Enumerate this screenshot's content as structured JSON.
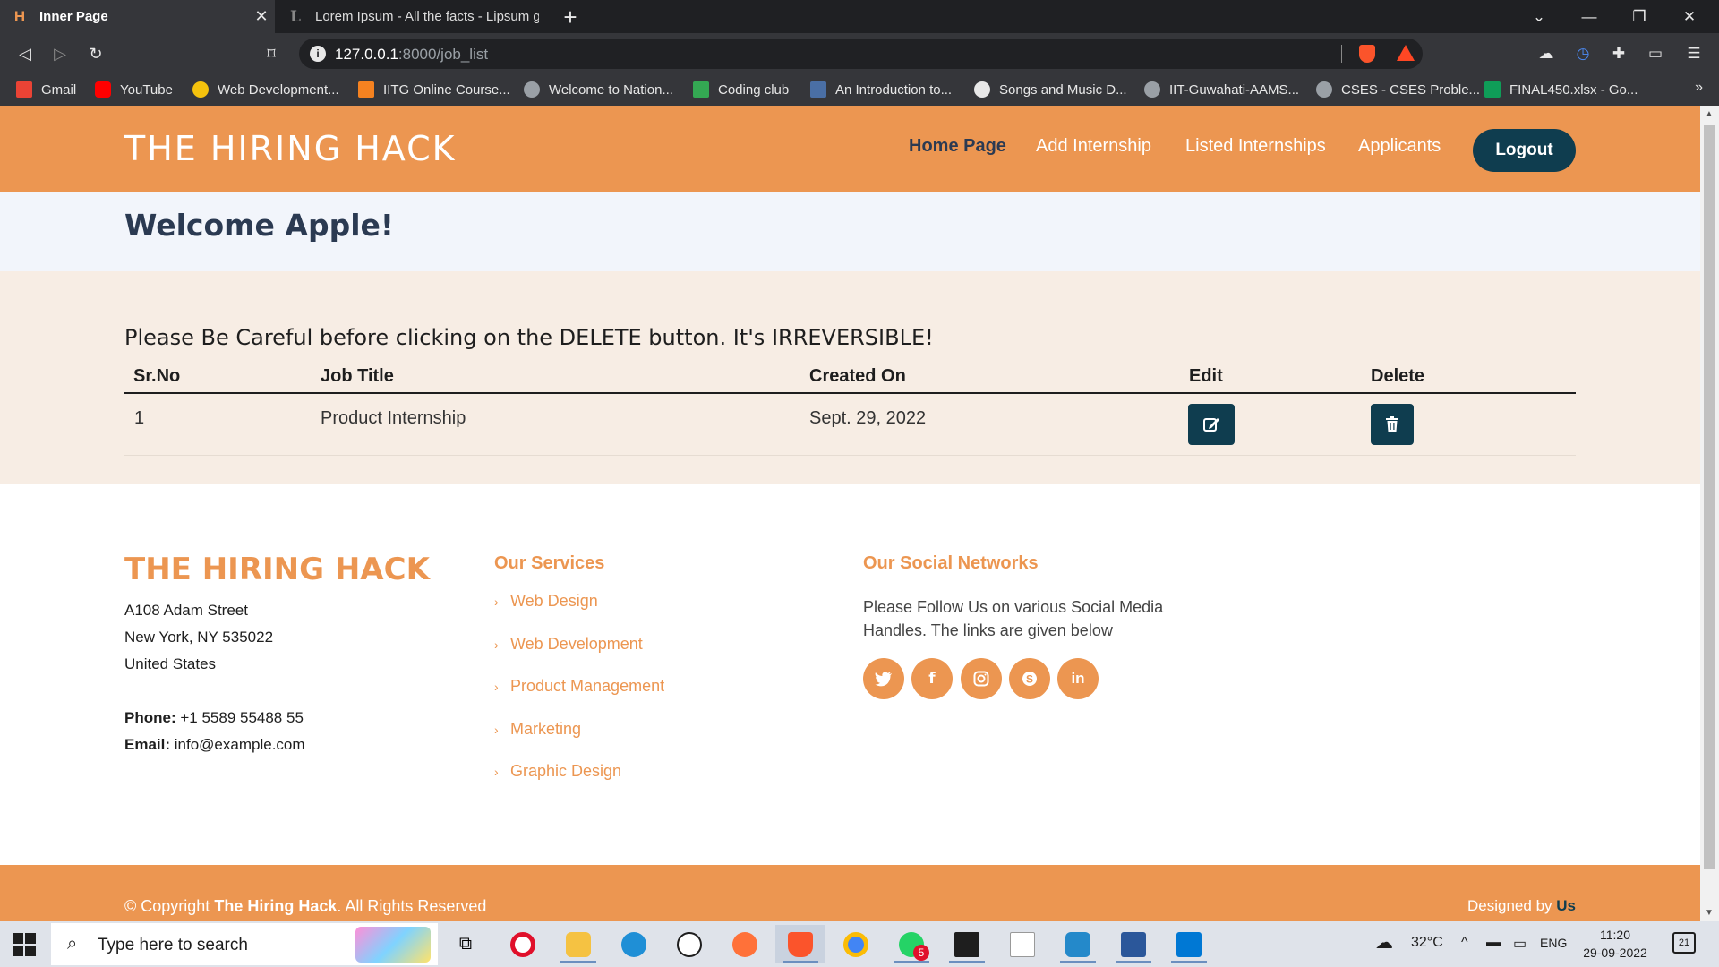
{
  "browser": {
    "tabs": [
      {
        "title": "Inner Page",
        "active": true
      },
      {
        "title": "Lorem Ipsum - All the facts - Lipsum g",
        "active": false
      }
    ],
    "url_host": "127.0.0.1",
    "url_rest": ":8000/job_list",
    "bookmarks": [
      {
        "label": "Gmail",
        "color": "#ea4335"
      },
      {
        "label": "YouTube",
        "color": "#ff0000"
      },
      {
        "label": "Web Development...",
        "color": "#f4c20d"
      },
      {
        "label": "IITG Online Course...",
        "color": "#f58220"
      },
      {
        "label": "Welcome to Nation...",
        "color": "#9aa0a6"
      },
      {
        "label": "Coding club",
        "color": "#34a853"
      },
      {
        "label": "An Introduction to...",
        "color": "#4a6fa5"
      },
      {
        "label": "Songs and Music D...",
        "color": "#e8e8e8"
      },
      {
        "label": "IIT-Guwahati-AAMS...",
        "color": "#9aa0a6"
      },
      {
        "label": "CSES - CSES Proble...",
        "color": "#9aa0a6"
      },
      {
        "label": "FINAL450.xlsx - Go...",
        "color": "#0f9d58"
      }
    ],
    "bookmarks_more": "»"
  },
  "site": {
    "brand": "THE HIRING HACK",
    "nav": [
      "Home Page",
      "Add Internship",
      "Listed Internships",
      "Applicants"
    ],
    "logout": "Logout",
    "welcome": "Welcome Apple!",
    "warning": "Please Be Careful before clicking on the DELETE button. It's IRREVERSIBLE!",
    "table": {
      "headers": [
        "Sr.No",
        "Job Title",
        "Created On",
        "Edit",
        "Delete"
      ],
      "rows": [
        {
          "sr": "1",
          "title": "Product Internship",
          "created": "Sept. 29, 2022"
        }
      ]
    },
    "footer": {
      "brand": "THE HIRING HACK",
      "address": [
        "A108 Adam Street",
        "New York, NY 535022",
        "United States"
      ],
      "phone_label": "Phone:",
      "phone": "+1 5589 55488 55",
      "email_label": "Email:",
      "email": "info@example.com",
      "services_title": "Our Services",
      "services": [
        "Web Design",
        "Web Development",
        "Product Management",
        "Marketing",
        "Graphic Design"
      ],
      "social_title": "Our Social Networks",
      "social_text_1": "Please Follow Us on various Social Media",
      "social_text_2": "Handles. The links are given below",
      "social_icons": [
        "twitter-icon",
        "facebook-icon",
        "instagram-icon",
        "skype-icon",
        "linkedin-icon"
      ],
      "copy_prefix": "© Copyright",
      "copy_brand": "The Hiring Hack",
      "copy_suffix": ". All Rights Reserved",
      "designed_prefix": "Designed by",
      "designed_by": "Us"
    },
    "colors": {
      "accent": "#ec9651",
      "dark": "#0f3d4f",
      "title": "#2b3a52"
    }
  },
  "taskbar": {
    "search_placeholder": "Type here to search",
    "temperature": "32°C",
    "language": "ENG",
    "time": "11:20",
    "date": "29-09-2022",
    "notifications": "21",
    "whatsapp_badge": "5"
  }
}
